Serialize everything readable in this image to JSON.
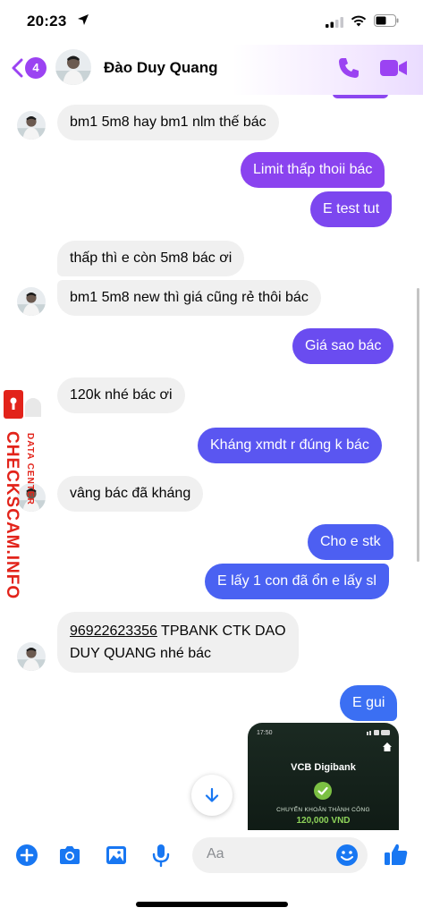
{
  "status_bar": {
    "time": "20:23"
  },
  "header": {
    "unread_count": "4",
    "contact_name": "Đào Duy Quang"
  },
  "colors": {
    "accent": "#9b43f2",
    "incoming_bubble": "#f0f0f0",
    "icon_blue": "#1877f2",
    "watermark_red": "#e2231a"
  },
  "messages": [
    {
      "dir": "in",
      "text": "bm1 5m8 hay bm1 nlm thế bác",
      "bg": "#f0f0f0"
    },
    {
      "dir": "out",
      "text": "Limit thấp thoii bác",
      "bg": "#8a43ef"
    },
    {
      "dir": "out",
      "text": "E test tut",
      "bg": "#7c47ef"
    },
    {
      "dir": "in",
      "text": "thấp thì e còn 5m8 bác ơi",
      "bg": "#f0f0f0"
    },
    {
      "dir": "in",
      "text": "bm1 5m8 new thì giá cũng rẻ thôi bác",
      "bg": "#f0f0f0"
    },
    {
      "dir": "out",
      "text": "Giá sao bác",
      "bg": "#6a4cf0"
    },
    {
      "dir": "in",
      "text": "120k nhé bác ơi",
      "bg": "#f0f0f0"
    },
    {
      "dir": "out",
      "text": "Kháng xmdt r đúng k bác",
      "bg": "#5a56f1"
    },
    {
      "dir": "in",
      "text": "vâng bác đã kháng",
      "bg": "#f0f0f0"
    },
    {
      "dir": "out",
      "text": "Cho e stk",
      "bg": "#4d5ff2"
    },
    {
      "dir": "out",
      "text": "E lấy 1 con đã ổn e lấy sl",
      "bg": "#4a62f2"
    },
    {
      "dir": "in",
      "text_link": "96922623356",
      "text_rest": " TPBANK CTK DAO",
      "text_line2": "DUY QUANG nhé bác",
      "bg": "#f0f0f0"
    },
    {
      "dir": "out",
      "text": "E gui",
      "bg": "#3b6ff3"
    }
  ],
  "receipt": {
    "time": "17:50",
    "brand": "VCB Digibank",
    "label": "CHUYỂN KHOẢN THÀNH CÔNG",
    "amount": "120,000 VND"
  },
  "watermark": {
    "main": "CHECKSCAM.INFO",
    "sub": "DATA CENTER"
  },
  "composer": {
    "placeholder": "Aa"
  },
  "icons": [
    "location-arrow-icon",
    "signal-icon",
    "wifi-icon",
    "battery-icon",
    "chevron-left-icon",
    "phone-icon",
    "video-camera-icon",
    "arrow-down-icon",
    "plus-icon",
    "camera-icon",
    "photo-icon",
    "microphone-icon",
    "emoji-icon",
    "thumbs-up-icon"
  ]
}
